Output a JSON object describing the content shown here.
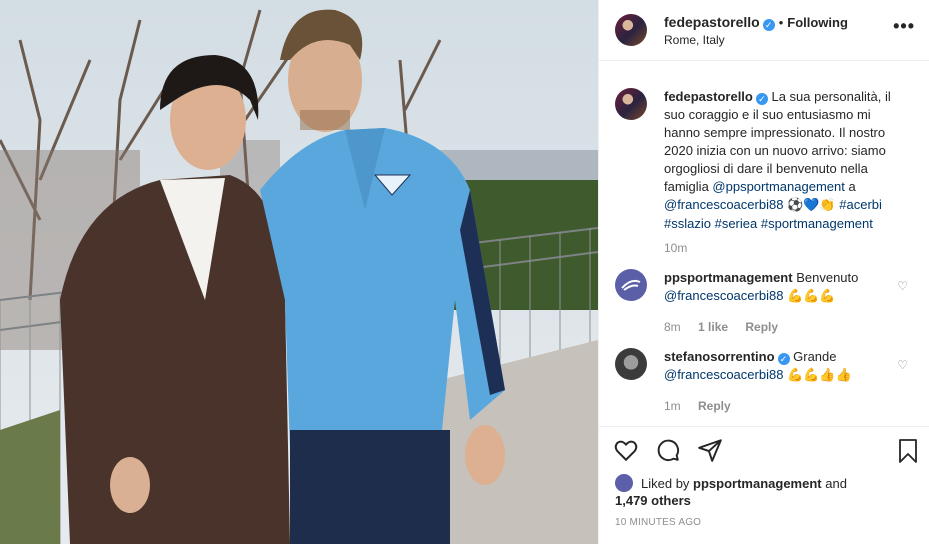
{
  "post": {
    "username": "fedepastorello",
    "follow_state": "Following",
    "location": "Rome, Italy",
    "more_icon": "more-horizontal-icon"
  },
  "caption": {
    "username": "fedepastorello",
    "text": "La sua personalità, il suo coraggio e il suo entusiasmo mi hanno sempre impressionato. Il nostro 2020 inizia con un nuovo arrivo: siamo orgogliosi di dare il benvenuto nella famiglia",
    "mention1": "@ppsportmanagement",
    "connector": "a",
    "mention2": "@francescoacerbi88",
    "emojis": "⚽💙👏",
    "tags": [
      "#acerbi",
      "#sslazio",
      "#seriea",
      "#sportmanagement"
    ],
    "time": "10m"
  },
  "comments": [
    {
      "username": "ppsportmanagement",
      "text": "Benvenuto",
      "mention": "@francescoacerbi88",
      "emojis": "💪💪💪",
      "time": "8m",
      "likes": "1 like",
      "reply": "Reply"
    },
    {
      "username": "stefanosorrentino",
      "text": "Grande",
      "mention": "@francescoacerbi88",
      "emojis": "💪💪👍👍",
      "time": "1m",
      "reply": "Reply"
    }
  ],
  "likes": {
    "prefix": "Liked by",
    "user": "ppsportmanagement",
    "and": "and",
    "others": "1,479 others"
  },
  "timestamp": "10 MINUTES AGO",
  "colors": {
    "link": "#00376b",
    "verified": "#3897f0",
    "muted": "#8e8e8e",
    "jacket": "#5aa7dd"
  }
}
